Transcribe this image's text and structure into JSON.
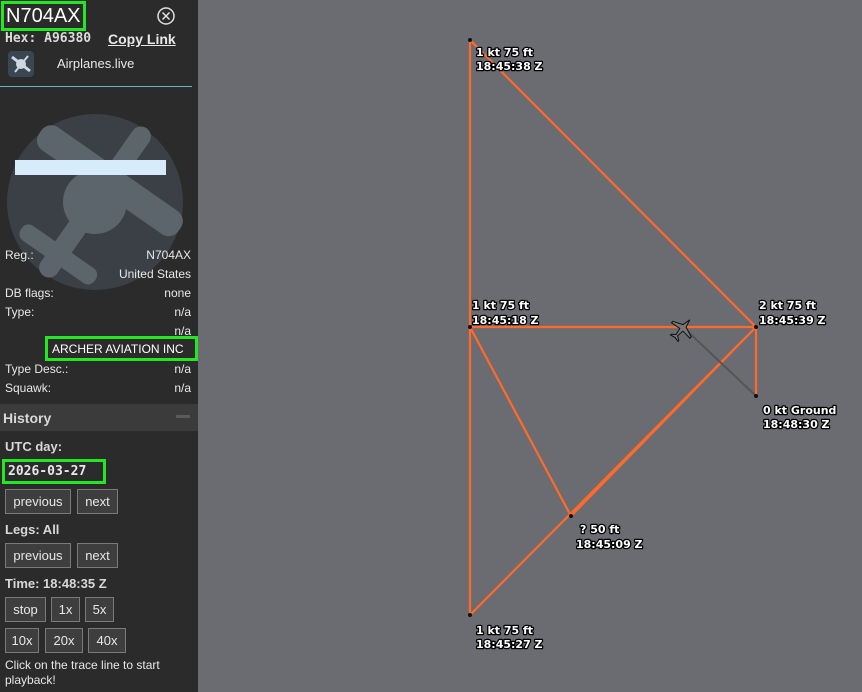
{
  "aircraft": {
    "callsign": "N704AX",
    "hex_label": "Hex:",
    "hex": "A96380",
    "copy_link": "Copy Link",
    "source_name": "Airplanes.live",
    "details": [
      {
        "label": "Reg.:",
        "value": "N704AX"
      },
      {
        "label": "",
        "value": "United States"
      },
      {
        "label": "DB flags:",
        "value": "none"
      },
      {
        "label": "Type:",
        "value": "n/a"
      },
      {
        "label": "",
        "value": "n/a"
      }
    ],
    "owner": "ARCHER AVIATION INC",
    "details2": [
      {
        "label": "Type Desc.:",
        "value": "n/a"
      },
      {
        "label": "Squawk:",
        "value": "n/a"
      }
    ]
  },
  "history": {
    "title": "History",
    "utc_day_label": "UTC day:",
    "date": "2026-03-27",
    "previous": "previous",
    "next": "next",
    "legs_label": "Legs: All",
    "time_label": "Time: 18:48:35 Z",
    "speed_buttons": [
      "stop",
      "1x",
      "5x",
      "10x",
      "20x",
      "40x"
    ],
    "hint": "Click on the trace line to start playback!"
  },
  "map": {
    "trace_color": "#ff6a2a",
    "labels": [
      {
        "line1": "1 kt    75 ft",
        "line2": "18:45:38 Z"
      },
      {
        "line1": "1 kt    75 ft",
        "line2": "18:45:18 Z"
      },
      {
        "line1": "2 kt    75 ft",
        "line2": "18:45:39 Z"
      },
      {
        "line1": "0 kt  Ground",
        "line2": "18:48:30 Z"
      },
      {
        "line1": "?    50 ft",
        "line2": "18:45:09 Z"
      },
      {
        "line1": "1 kt    75 ft",
        "line2": "18:45:27 Z"
      }
    ]
  }
}
